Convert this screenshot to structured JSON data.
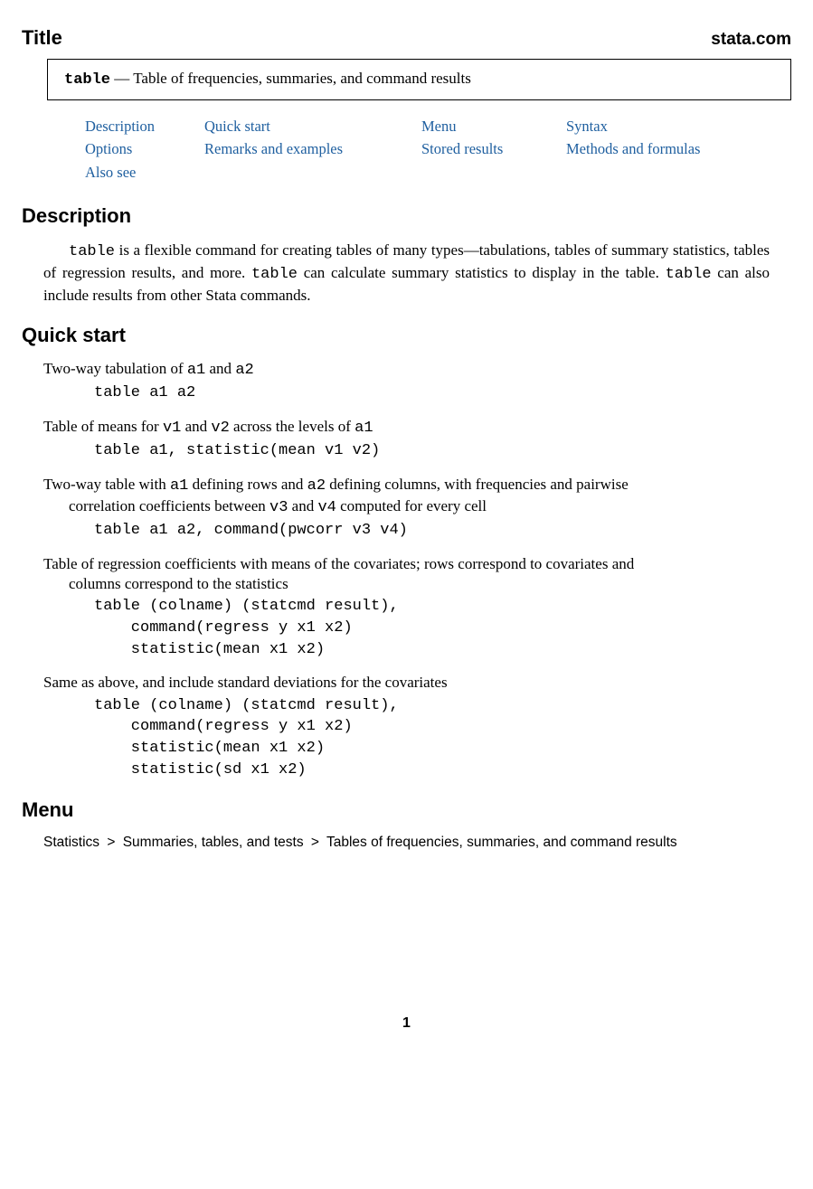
{
  "header": {
    "title": "Title",
    "brand": "stata.com"
  },
  "titlebox": {
    "cmd": "table",
    "dash": " — ",
    "subtitle": "Table of frequencies, summaries, and command results"
  },
  "nav": {
    "r1c1": "Description",
    "r1c2": "Quick start",
    "r1c3": "Menu",
    "r1c4": "Syntax",
    "r2c1": "Options",
    "r2c2": "Remarks and examples",
    "r2c3": "Stored results",
    "r2c4": "Methods and formulas",
    "r3c1": "Also see"
  },
  "description": {
    "heading": "Description",
    "p1a": "table",
    "p1b": " is a flexible command for creating tables of many types—tabulations, tables of summary statistics, tables of regression results, and more. ",
    "p1c": "table",
    "p1d": " can calculate summary statistics to display in the table. ",
    "p1e": "table",
    "p1f": " can also include results from other Stata commands."
  },
  "quickstart": {
    "heading": "Quick start",
    "items": [
      {
        "intro_parts": [
          "Two-way tabulation of ",
          "a1",
          " and ",
          "a2"
        ],
        "code": "table a1 a2"
      },
      {
        "intro_parts": [
          "Table of means for ",
          "v1",
          " and ",
          "v2",
          " across the levels of ",
          "a1"
        ],
        "code": "table a1, statistic(mean v1 v2)"
      },
      {
        "intro_parts": [
          "Two-way table with ",
          "a1",
          " defining rows and ",
          "a2",
          " defining columns, with frequencies and pairwise"
        ],
        "cont_parts": [
          "correlation coefficients between ",
          "v3",
          " and ",
          "v4",
          " computed for every cell"
        ],
        "code": "table a1 a2, command(pwcorr v3 v4)"
      },
      {
        "intro_parts": [
          "Table of regression coefficients with means of the covariates; rows correspond to covariates and"
        ],
        "cont_parts": [
          "columns correspond to the statistics"
        ],
        "code": "table (colname) (statcmd result),\n    command(regress y x1 x2)\n    statistic(mean x1 x2)"
      },
      {
        "intro_parts": [
          "Same as above, and include standard deviations for the covariates"
        ],
        "code": "table (colname) (statcmd result),\n    command(regress y x1 x2)\n    statistic(mean x1 x2)\n    statistic(sd x1 x2)"
      }
    ]
  },
  "menu": {
    "heading": "Menu",
    "path1": "Statistics",
    "gt": ">",
    "path2": "Summaries, tables, and tests",
    "path3": "Tables of frequencies, summaries, and command results"
  },
  "pagenum": "1"
}
